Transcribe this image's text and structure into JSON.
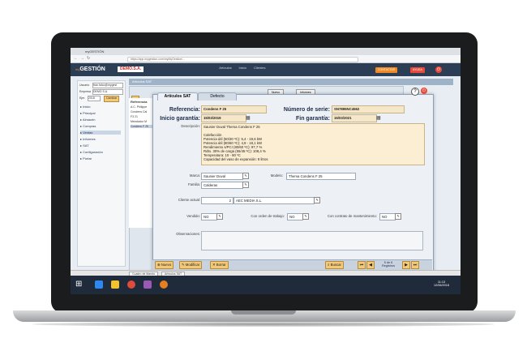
{
  "browser": {
    "tab_label": "myGESTIÓN",
    "url": "https://app.mygestion.com/myMyGestion/..."
  },
  "app": {
    "logo_prefix": "my",
    "logo": "GESTIÓN",
    "company": "DEMO.S.A.",
    "top_nav": [
      "Artículos",
      "Inicio",
      "Clientes"
    ],
    "btn_contact": "CONTACTAR",
    "btn_help": "AYUDA"
  },
  "sidebar": {
    "user_label": "Usuario",
    "user_value": "fran.falco@mygest",
    "company_label": "Empresa",
    "company_value": "DEMO S.A.",
    "year_label": "Ejer.",
    "year_value": "2018",
    "change_btn": "Cambiar",
    "items": [
      "Inicio",
      "Principal",
      "Almacén",
      "Compras",
      "Ventas",
      "Informes",
      "SAT",
      "Configuración",
      "Portar"
    ]
  },
  "background_window": {
    "title": "Artículos SAT",
    "btn_new": "Nuevo",
    "btn_report": "Informes",
    "list_header": "Referencia",
    "list_items": [
      "A.C. Philippe",
      "Condens Cal",
      "F3 21",
      "Mezclador M",
      "Condens F 25"
    ]
  },
  "modal": {
    "tab_active": "Artículos SAT",
    "tab_other": "Defecto",
    "referencia_label": "Referencia:",
    "referencia_value": "Condens F 25",
    "serie_label": "Número de serie:",
    "serie_value": "SN7895NC4562",
    "inicio_label": "Inicio garantía:",
    "inicio_value": "15/03/2019",
    "fin_label": "Fin garantía:",
    "fin_value": "15/03/2021",
    "descripcion_label": "Descripción:",
    "descripcion_lines": [
      "Saunier Duval Thema Condens F 25",
      "",
      "Calefacción",
      "Potencia útil (50/30 ºC): 5,4 - 19,6 kW",
      "Potencia útil (80/60 ºC): 4,9 - 18,1 kW",
      "Rendimiento s/PCI (80/60 ºC): 97,7 %",
      "Rdto. 30% de carga (55/45 ºC): 108,4 %",
      "Temperatura: 10 - 80 ºC",
      "Capacidad del vaso de expansión: 8 litros"
    ],
    "marca_label": "Marca:",
    "marca_value": "Saunier Duval",
    "modelo_label": "Modelo:",
    "modelo_value": "Thema Condens F 25",
    "familia_label": "Familia:",
    "familia_value": "Calderas",
    "cliente_label": "Cliente actual:",
    "cliente_code": "2",
    "cliente_name": "AEC MEDIA S.L.",
    "vendido_label": "Vendido:",
    "vendido_value": "NO",
    "orden_label": "Con orden de trabajo:",
    "orden_value": "NO",
    "contrato_label": "Con contrato de mantenimiento:",
    "contrato_value": "NO",
    "observaciones_label": "Observaciones:",
    "btn_nuevo": "Nuevo",
    "btn_modificar": "Modificar",
    "btn_borrar": "Borrar",
    "btn_buscar": "Buscar",
    "record_info_1": "5 de 6",
    "record_info_2": "Registros"
  },
  "status_tabs": [
    "Cuadro de Mando",
    "Artículos SAT"
  ],
  "taskbar": {
    "time": "11:13",
    "date": "12/06/2018"
  },
  "colors": {
    "topbar": "#2c3e55",
    "accent": "#f08a24",
    "field_bg": "#f7e7c9",
    "button_bg": "#f2c879"
  }
}
